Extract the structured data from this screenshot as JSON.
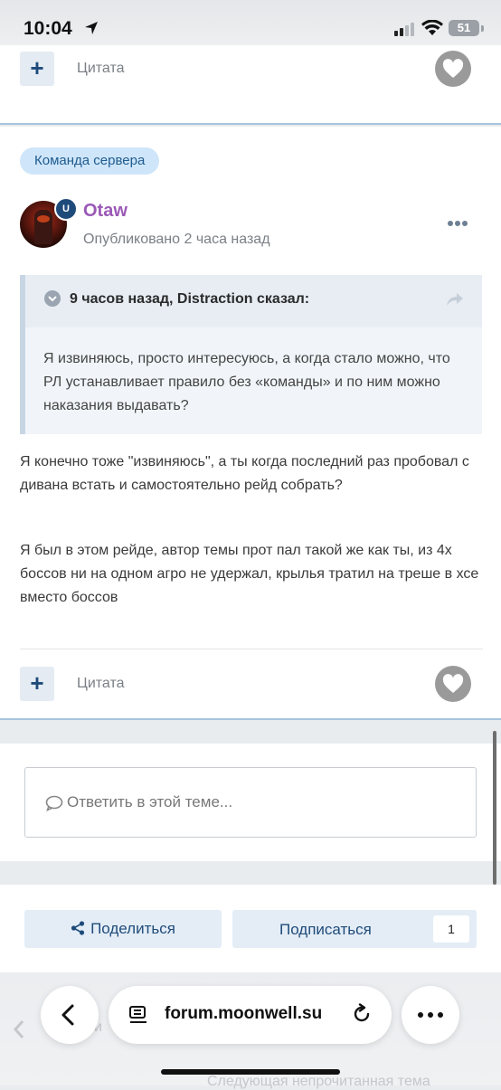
{
  "status_bar": {
    "time": "10:04",
    "battery": "51"
  },
  "prev_post": {
    "quote_label": "Цитата"
  },
  "post": {
    "badge": "Команда сервера",
    "rank_letter": "U",
    "author": "Otaw",
    "posted": "Опубликовано 2 часа назад",
    "quote": {
      "title": "9 часов назад, Distraction сказал:",
      "body": "Я извиняюсь, просто интересуюсь, а когда стало можно, что РЛ устанавливает  правило  без «команды» и по ним можно наказания выдавать?"
    },
    "paragraphs": [
      "Я конечно тоже \"извиняюсь\", а ты когда последний раз пробовал с дивана встать и самостоятельно рейд собрать?",
      "Я был в этом рейде, автор темы прот пал такой же как ты, из 4х боссов ни на одном агро не удержал, крылья тратил на треше в хсе вместо боссов"
    ],
    "quote_label": "Цитата"
  },
  "reply": {
    "placeholder": "Ответить в этой теме..."
  },
  "actions": {
    "share_label": "Поделиться",
    "subscribe_label": "Подписаться",
    "subscribe_count": "1"
  },
  "browser": {
    "url": "forum.moonwell.su",
    "ghost_left": "и",
    "ghost_bottom": "Следующая непрочитанная тема"
  },
  "colors": {
    "accent": "#1f4b7a",
    "author": "#9b59b6",
    "badge_bg": "#cfe6fa"
  }
}
